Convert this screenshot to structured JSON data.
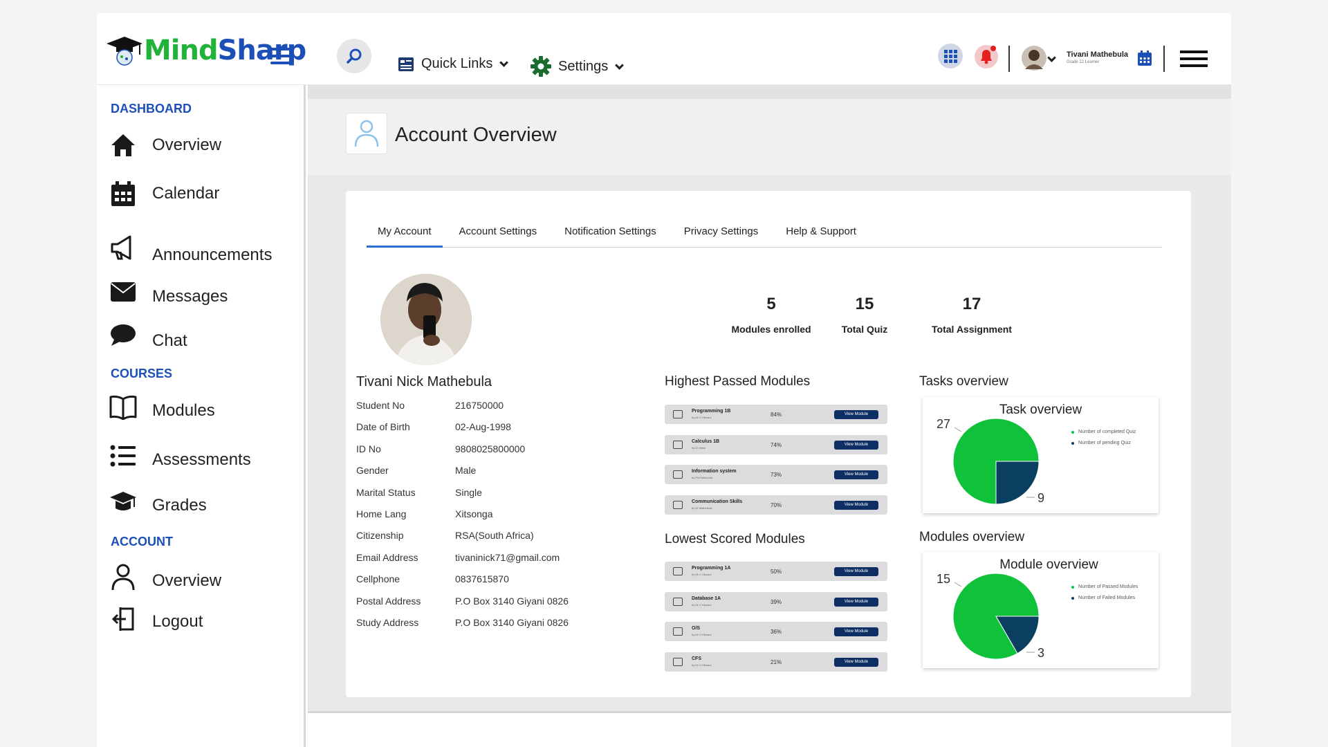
{
  "header": {
    "logo": {
      "part1": "Mind",
      "part2": "Sharp"
    },
    "quick_links": "Quick Links",
    "settings": "Settings",
    "user": {
      "name": "Tivani Mathebula",
      "grade": "Grade 12 Learner"
    }
  },
  "sidebar": {
    "dashboard_title": "DASHBOARD",
    "dashboard_items": [
      {
        "label": "Overview",
        "icon": "home-icon"
      },
      {
        "label": "Calendar",
        "icon": "calendar-icon"
      },
      {
        "label": "Announcements",
        "icon": "megaphone-icon"
      },
      {
        "label": "Messages",
        "icon": "envelope-icon"
      },
      {
        "label": "Chat",
        "icon": "chat-bubble-icon"
      }
    ],
    "courses_title": "COURSES",
    "courses_items": [
      {
        "label": "Modules",
        "icon": "book-icon"
      },
      {
        "label": "Assessments",
        "icon": "list-icon"
      },
      {
        "label": "Grades",
        "icon": "graduation-cap-icon"
      }
    ],
    "account_title": "ACCOUNT",
    "account_items": [
      {
        "label": "Overview",
        "icon": "user-icon"
      },
      {
        "label": "Logout",
        "icon": "logout-icon"
      }
    ]
  },
  "page": {
    "title": "Account Overview",
    "tabs": [
      "My Account",
      "Account Settings",
      "Notification Settings",
      "Privacy Settings",
      "Help & Support"
    ],
    "active_tab": "My Account"
  },
  "stats": [
    {
      "value": "5",
      "label": "Modules enrolled"
    },
    {
      "value": "15",
      "label": "Total Quiz"
    },
    {
      "value": "17",
      "label": "Total Assignment"
    }
  ],
  "profile": {
    "full_name": "Tivani Nick Mathebula",
    "fields": [
      {
        "key": "Student No",
        "value": "216750000"
      },
      {
        "key": "Date of Birth",
        "value": "02-Aug-1998"
      },
      {
        "key": "ID No",
        "value": "9808025800000"
      },
      {
        "key": "Gender",
        "value": "Male"
      },
      {
        "key": "Marital Status",
        "value": "Single"
      },
      {
        "key": "Home Lang",
        "value": "Xitsonga"
      },
      {
        "key": "Citizenship",
        "value": "RSA(South Africa)"
      },
      {
        "key": "Email Address",
        "value": "tivaninick71@gmail.com"
      },
      {
        "key": "Cellphone",
        "value": "0837615870"
      },
      {
        "key": "Postal Address",
        "value": "P.O Box 3140 Giyani 0826"
      },
      {
        "key": "Study Address",
        "value": "P.O Box 3140 Giyani 0826"
      }
    ]
  },
  "highest_modules": {
    "title": "Highest Passed Modules",
    "items": [
      {
        "name": "Programming 1B",
        "by": "by Mr V Hlonani",
        "percent": "84%",
        "button": "View Module"
      },
      {
        "name": "Calculus 1B",
        "by": "by Dr Hlela",
        "percent": "74%",
        "button": "View Module"
      },
      {
        "name": "Information system",
        "by": "by Prof Makunda",
        "percent": "73%",
        "button": "View Module"
      },
      {
        "name": "Communication Skills",
        "by": "by Dr Mathebula",
        "percent": "70%",
        "button": "View Module"
      }
    ]
  },
  "lowest_modules": {
    "title": "Lowest Scored Modules",
    "items": [
      {
        "name": "Programming 1A",
        "by": "by Mr V Hlonani",
        "percent": "50%",
        "button": "View Module"
      },
      {
        "name": "Database 1A",
        "by": "by Mr V Hlonani",
        "percent": "39%",
        "button": "View Module"
      },
      {
        "name": "O/S",
        "by": "by Mr V Hlonani",
        "percent": "36%",
        "button": "View Module"
      },
      {
        "name": "CFS",
        "by": "by Mr V Hlonani",
        "percent": "21%",
        "button": "View Module"
      }
    ]
  },
  "tasks_overview": {
    "heading": "Tasks overview"
  },
  "modules_overview": {
    "heading": "Modules overview"
  },
  "chart_data": [
    {
      "type": "pie",
      "title": "Task overview",
      "categories": [
        "Number of completed Quiz",
        "Number of pending Quiz"
      ],
      "values": [
        27,
        9
      ],
      "colors": [
        "#10c23a",
        "#0b3f61"
      ],
      "legend": "right"
    },
    {
      "type": "pie",
      "title": "Module overview",
      "categories": [
        "Number of Passed Modules",
        "Number of Failed Modules"
      ],
      "values": [
        15,
        3
      ],
      "colors": [
        "#10c23a",
        "#0b3f61"
      ],
      "legend": "right"
    }
  ],
  "colors": {
    "brand_blue": "#1c4fb8",
    "brand_green": "#1fb33a",
    "button_navy": "#0d2f63"
  }
}
